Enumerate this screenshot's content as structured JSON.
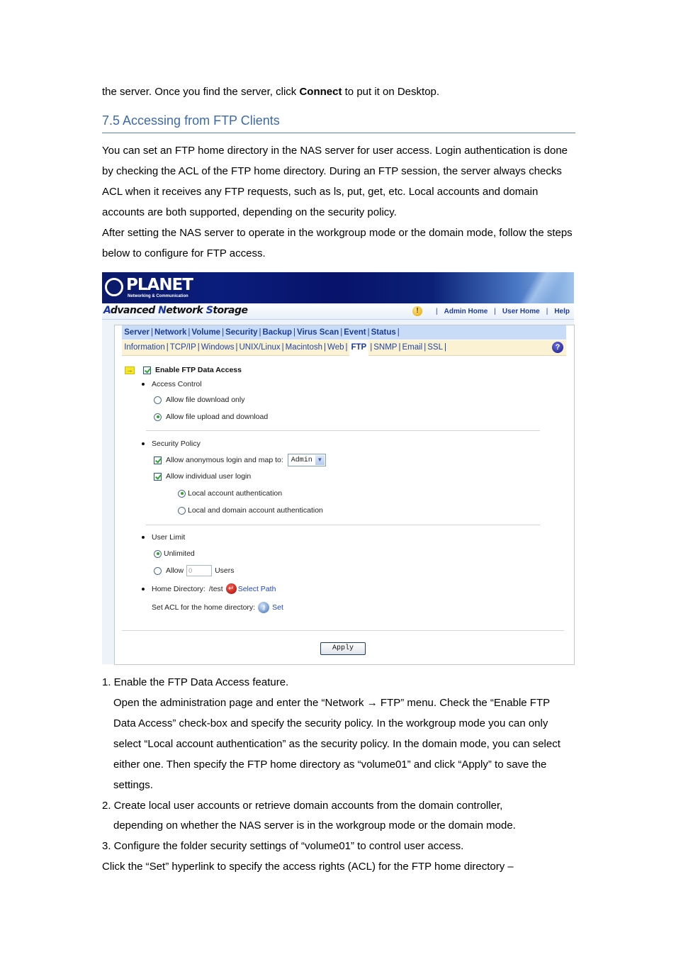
{
  "intro": {
    "pre": "the server. Once you find the server, click ",
    "bold": "Connect",
    "post": " to put it on Desktop."
  },
  "section_title": "7.5 Accessing from FTP Clients",
  "paragraphs": [
    "You can set an FTP home directory in the NAS server for user access. Login authentication is done by checking the ACL of the FTP home directory. During an FTP session, the server always checks ACL when it receives any FTP requests, such as ls, put, get, etc. Local accounts and domain accounts are both supported, depending on the security policy.",
    "After setting the NAS server to operate in the workgroup mode or the domain mode, follow the steps below to configure for FTP access."
  ],
  "app": {
    "logo": "PLANET",
    "logo_sub": "Networking & Communication",
    "product": {
      "p1": "A",
      "p2": "dvanced ",
      "p3": "N",
      "p4": "etwork ",
      "p5": "S",
      "p6": "torage"
    },
    "top_links": [
      "Admin Home",
      "User Home",
      "Help"
    ],
    "menu_main": [
      "Server",
      "Network",
      "Volume",
      "Security",
      "Backup",
      "Virus Scan",
      "Event",
      "Status"
    ],
    "menu_sub": [
      "Information",
      "TCP/IP",
      "Windows",
      "UNIX/Linux",
      "Macintosh",
      "Web",
      "FTP",
      "SNMP",
      "Email",
      "SSL"
    ],
    "active_sub": "FTP",
    "form": {
      "enable_label": "Enable FTP Data Access",
      "enable_checked": true,
      "access_control": "Access Control",
      "ac_opt1": "Allow file download only",
      "ac_opt2": "Allow file upload and download",
      "security_policy": "Security Policy",
      "anon_label": "Allow anonymous login and map to:",
      "anon_checked": true,
      "anon_user": "Admin",
      "individual_label": "Allow individual user login",
      "individual_checked": true,
      "auth_opt1": "Local account authentication",
      "auth_opt2": "Local and domain account authentication",
      "user_limit": "User Limit",
      "ul_opt1": "Unlimited",
      "ul_opt2": "Allow",
      "ul_value": "0",
      "ul_users": "Users",
      "home_dir_label": "Home Directory:",
      "home_dir_value": "/test",
      "select_path": "Select Path",
      "acl_label": "Set ACL for the home directory:",
      "acl_set": "Set",
      "apply": "Apply"
    }
  },
  "steps": [
    "1. Enable the FTP Data Access feature.",
    "Open the administration page and enter the “Network → FTP” menu. Check the “Enable FTP Data Access” check-box and specify the security policy. In the workgroup mode you can only select “Local account authentication” as the security policy. In the domain mode, you can select either one. Then specify the FTP home directory as “volume01” and click “Apply” to save the settings.",
    "2. Create local user accounts or retrieve domain accounts from the domain controller,",
    "depending on whether the NAS server is in the workgroup mode or the domain mode.",
    "3. Configure the folder security settings of “volume01” to control user access.",
    "Click the “Set” hyperlink to specify the access rights (ACL) for the FTP home directory –"
  ]
}
